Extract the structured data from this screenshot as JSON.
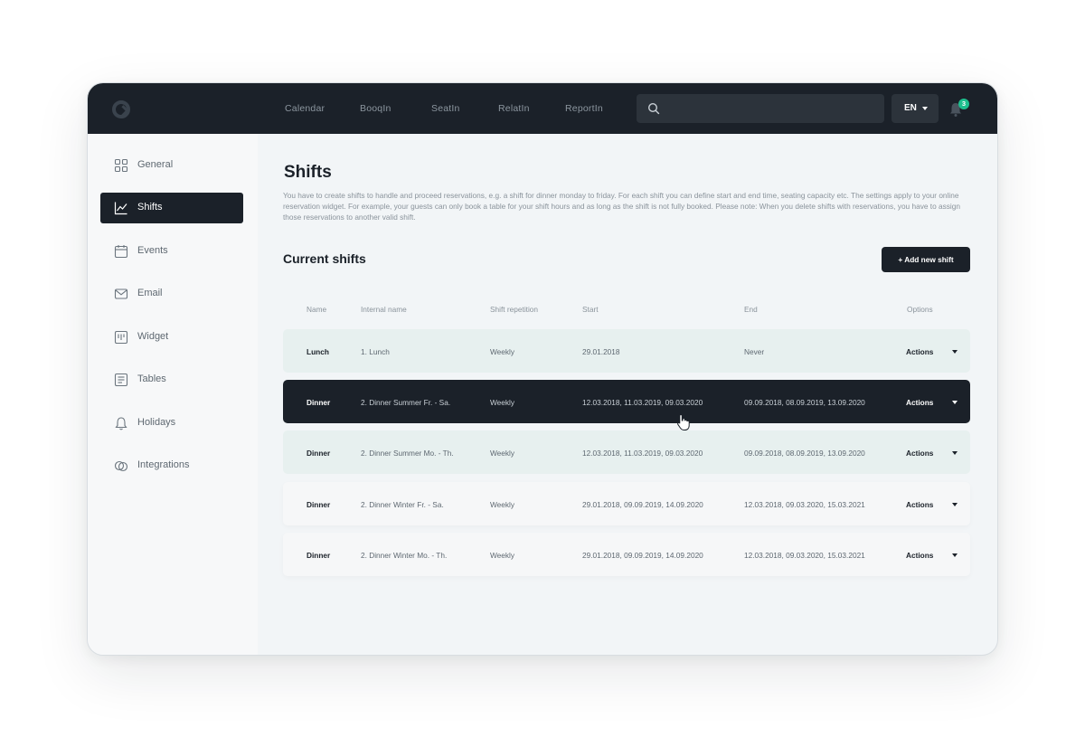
{
  "nav": [
    "Calendar",
    "BooqIn",
    "SeatIn",
    "RelatIn",
    "ReportIn"
  ],
  "search": {
    "placeholder": ""
  },
  "language": "EN",
  "notifications": {
    "count": "3"
  },
  "sidebar": {
    "items": [
      {
        "label": "General",
        "icon": "grid-icon"
      },
      {
        "label": "Shifts",
        "icon": "chart-line-icon",
        "active": true
      },
      {
        "label": "Events",
        "icon": "calendar-icon"
      },
      {
        "label": "Email",
        "icon": "mail-icon"
      },
      {
        "label": "Widget",
        "icon": "widget-icon"
      },
      {
        "label": "Tables",
        "icon": "list-icon"
      },
      {
        "label": "Holidays",
        "icon": "bell-icon"
      },
      {
        "label": "Integrations",
        "icon": "integrations-icon"
      }
    ]
  },
  "page": {
    "title": "Shifts",
    "description": "You have to create shifts to handle and proceed reservations, e.g. a shift for dinner monday to friday. For each shift you can define start and end time, seating capacity etc. The settings apply to your online reservation widget. For example, your guests can only book a table for your shift hours and as long as the shift is not fully booked. Please note: When you delete shifts with reservations, you have to assign those reservations to another valid shift.",
    "section_title": "Current shifts",
    "add_button": "+ Add new shift"
  },
  "table": {
    "headers": [
      "Name",
      "Internal name",
      "Shift repetition",
      "Start",
      "End",
      "Options"
    ],
    "rows": [
      {
        "name": "Lunch",
        "internal": "1. Lunch",
        "repetition": "Weekly",
        "start": "29.01.2018",
        "end": "Never",
        "action": "Actions"
      },
      {
        "name": "Dinner",
        "internal": "2. Dinner Summer Fr. - Sa.",
        "repetition": "Weekly",
        "start": "12.03.2018, 11.03.2019, 09.03.2020",
        "end": "09.09.2018, 08.09.2019, 13.09.2020",
        "action": "Actions"
      },
      {
        "name": "Dinner",
        "internal": "2. Dinner Summer Mo. - Th.",
        "repetition": "Weekly",
        "start": "12.03.2018, 11.03.2019, 09.03.2020",
        "end": "09.09.2018, 08.09.2019, 13.09.2020",
        "action": "Actions"
      },
      {
        "name": "Dinner",
        "internal": "2. Dinner Winter Fr. - Sa.",
        "repetition": "Weekly",
        "start": "29.01.2018, 09.09.2019, 14.09.2020",
        "end": "12.03.2018, 09.03.2020, 15.03.2021",
        "action": "Actions"
      },
      {
        "name": "Dinner",
        "internal": "2. Dinner Winter Mo. - Th.",
        "repetition": "Weekly",
        "start": "29.01.2018, 09.09.2019, 14.09.2020",
        "end": "12.03.2018, 09.03.2020, 15.03.2021",
        "action": "Actions"
      }
    ]
  },
  "colors": {
    "dark": "#1b2129",
    "accent": "#1dbf8e",
    "row_highlight": "#e7f0ef"
  }
}
